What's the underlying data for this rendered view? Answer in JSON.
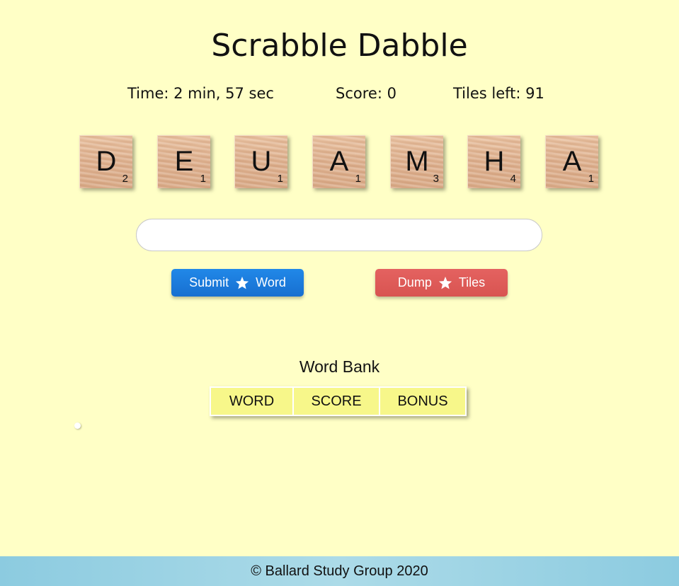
{
  "app": {
    "title": "Scrabble Dabble"
  },
  "stats": {
    "time": "Time: 2 min, 57 sec",
    "score": "Score: 0",
    "tiles_left": "Tiles left: 91"
  },
  "rack": [
    {
      "letter": "D",
      "points": "2"
    },
    {
      "letter": "E",
      "points": "1"
    },
    {
      "letter": "U",
      "points": "1"
    },
    {
      "letter": "A",
      "points": "1"
    },
    {
      "letter": "M",
      "points": "3"
    },
    {
      "letter": "H",
      "points": "4"
    },
    {
      "letter": "A",
      "points": "1"
    }
  ],
  "word_input": {
    "value": "",
    "placeholder": ""
  },
  "buttons": {
    "submit": {
      "left": "Submit",
      "right": "Word",
      "icon": "star-icon",
      "color": "#1a7ad8"
    },
    "dump": {
      "left": "Dump",
      "right": "Tiles",
      "icon": "star-icon",
      "color": "#de5b58"
    }
  },
  "word_bank": {
    "title": "Word Bank",
    "columns": [
      "WORD",
      "SCORE",
      "BONUS"
    ],
    "rows": []
  },
  "footer": {
    "text": "© Ballard Study Group 2020"
  },
  "colors": {
    "background": "#ffffc6",
    "table_header": "#f7f78a",
    "footer": "#a6d7e6"
  }
}
